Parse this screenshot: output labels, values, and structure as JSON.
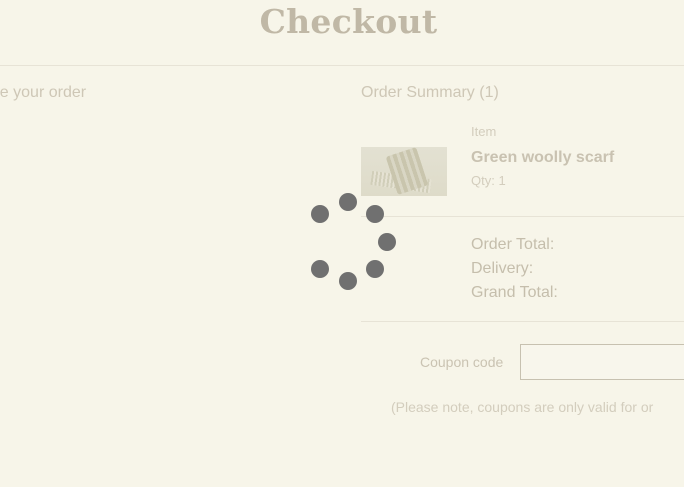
{
  "page": {
    "title": "Checkout"
  },
  "left_panel": {
    "heading": "plete your order"
  },
  "order_summary": {
    "heading": "Order Summary (1)",
    "item": {
      "label": "Item",
      "name": "Green woolly scarf",
      "qty": "Qty: 1",
      "image_icon": "scarf-image"
    },
    "totals": [
      {
        "label": "Order Total:"
      },
      {
        "label": "Delivery:"
      },
      {
        "label": "Grand Total:"
      }
    ]
  },
  "coupon": {
    "label": "Coupon code",
    "value": "",
    "note": "(Please note, coupons are only valid for or"
  },
  "loading_spinner": {
    "icon": "loading-spinner-icon",
    "dot_color": "#707070",
    "visible_dots": 7
  },
  "colors": {
    "background": "#f7f5e9",
    "title": "#c0b8a6",
    "muted_text": "#cec7b6",
    "divider": "#e7e3d6"
  }
}
